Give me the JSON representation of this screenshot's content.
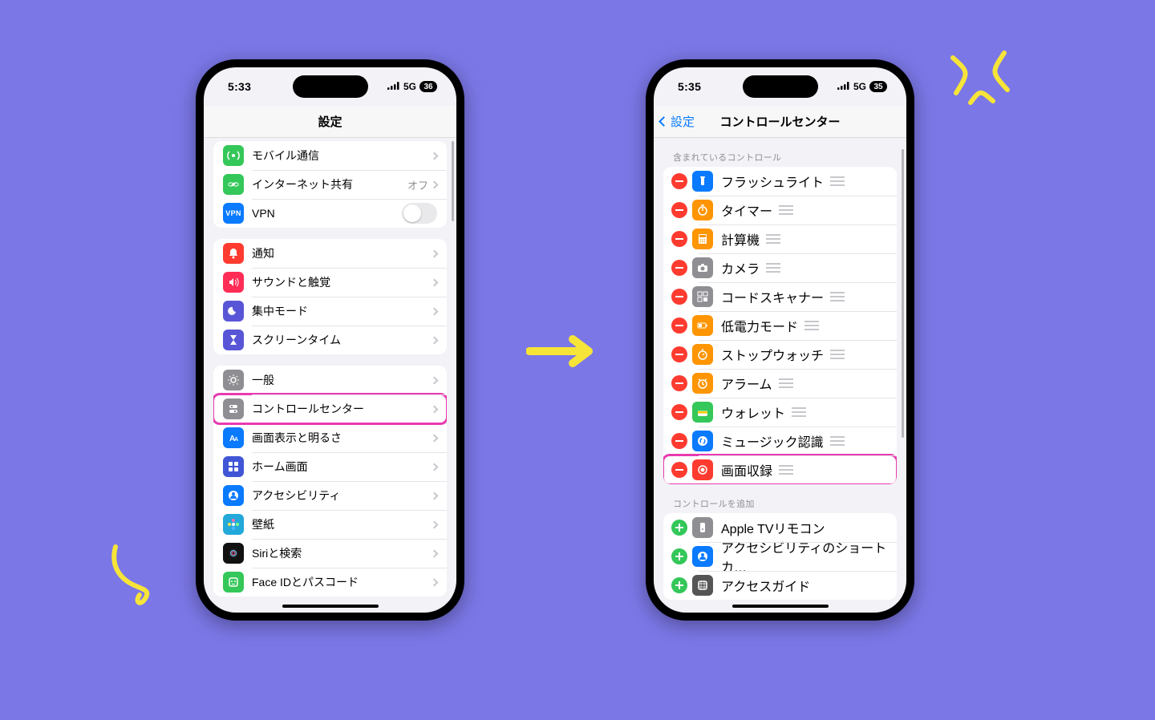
{
  "left": {
    "time": "5:33",
    "cellular": "5G",
    "battery": "36",
    "title": "設定",
    "g0": [
      {
        "label": "モバイル通信",
        "icon": "antenna",
        "color": "#34c759"
      },
      {
        "label": "インターネット共有",
        "icon": "link",
        "color": "#34c759",
        "detail": "オフ"
      },
      {
        "label": "VPN",
        "icon": "vpn",
        "color": "#0a7aff",
        "toggle": false
      }
    ],
    "g1": [
      {
        "label": "通知",
        "icon": "bell",
        "color": "#ff3b30"
      },
      {
        "label": "サウンドと触覚",
        "icon": "speaker",
        "color": "#ff2d55"
      },
      {
        "label": "集中モード",
        "icon": "moon",
        "color": "#5856d6"
      },
      {
        "label": "スクリーンタイム",
        "icon": "hourglass",
        "color": "#5856d6"
      }
    ],
    "g2": [
      {
        "label": "一般",
        "icon": "gear",
        "color": "#8e8e93"
      },
      {
        "label": "コントロールセンター",
        "icon": "sliders",
        "color": "#8e8e93",
        "hl": true
      },
      {
        "label": "画面表示と明るさ",
        "icon": "text",
        "color": "#0a7aff"
      },
      {
        "label": "ホーム画面",
        "icon": "grid",
        "color": "#4056d6"
      },
      {
        "label": "アクセシビリティ",
        "icon": "person",
        "color": "#0a7aff"
      },
      {
        "label": "壁紙",
        "icon": "flower",
        "color": "#22a8d9"
      },
      {
        "label": "Siriと検索",
        "icon": "siri",
        "color": "#111"
      },
      {
        "label": "Face IDとパスコード",
        "icon": "face",
        "color": "#34c759"
      }
    ]
  },
  "right": {
    "time": "5:35",
    "cellular": "5G",
    "battery": "35",
    "back": "設定",
    "title": "コントロールセンター",
    "included_header": "含まれているコントロール",
    "more_header": "コントロールを追加",
    "included": [
      {
        "label": "フラッシュライト",
        "icon": "flashlight",
        "color": "#0a7aff"
      },
      {
        "label": "タイマー",
        "icon": "timer",
        "color": "#ff9500"
      },
      {
        "label": "計算機",
        "icon": "calc",
        "color": "#ff9500"
      },
      {
        "label": "カメラ",
        "icon": "camera",
        "color": "#8e8e93"
      },
      {
        "label": "コードスキャナー",
        "icon": "qr",
        "color": "#8e8e93"
      },
      {
        "label": "低電力モード",
        "icon": "battery",
        "color": "#ff9500"
      },
      {
        "label": "ストップウォッチ",
        "icon": "stopwatch",
        "color": "#ff9500"
      },
      {
        "label": "アラーム",
        "icon": "alarm",
        "color": "#ff9500"
      },
      {
        "label": "ウォレット",
        "icon": "wallet",
        "color": "#34c759"
      },
      {
        "label": "ミュージック認識",
        "icon": "shazam",
        "color": "#0a7aff"
      },
      {
        "label": "画面収録",
        "icon": "record",
        "color": "#ff3b30",
        "hl": true
      }
    ],
    "more": [
      {
        "label": "Apple TVリモコン",
        "icon": "remote",
        "color": "#8e8e93"
      },
      {
        "label": "アクセシビリティのショートカ…",
        "icon": "person",
        "color": "#0a7aff"
      },
      {
        "label": "アクセスガイド",
        "icon": "guide",
        "color": "#555"
      }
    ]
  }
}
